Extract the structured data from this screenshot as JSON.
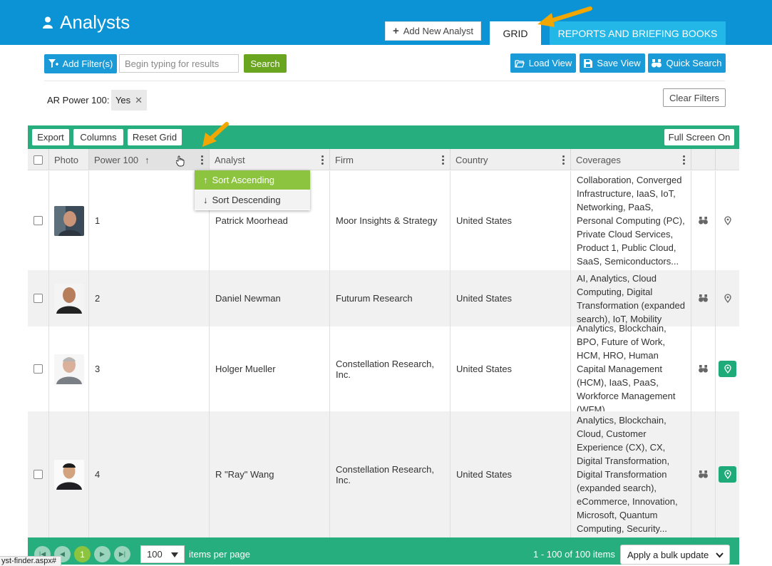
{
  "header": {
    "title": "Analysts",
    "add_analyst_label": "Add New Analyst",
    "tabs": [
      {
        "label": "GRID",
        "active": true
      },
      {
        "label": "REPORTS AND BRIEFING BOOKS",
        "active": false
      }
    ],
    "colors": {
      "bar": "#0b93d5",
      "tab_inactive": "#22b7e6"
    }
  },
  "toolbar": {
    "add_filter_label": "Add Filter(s)",
    "search_placeholder": "Begin typing for results",
    "search_value": "",
    "search_label": "Search",
    "load_view_label": "Load View",
    "save_view_label": "Save View",
    "quick_search_label": "Quick Search"
  },
  "filters": {
    "label": "AR Power 100:",
    "chip_value": "Yes",
    "clear_label": "Clear Filters"
  },
  "grid_toolbar": {
    "export_label": "Export",
    "columns_label": "Columns",
    "reset_label": "Reset Grid",
    "fullscreen_label": "Full Screen On",
    "color": "#27ae7f"
  },
  "columns": [
    "Photo",
    "Power 100",
    "Analyst",
    "Firm",
    "Country",
    "Coverages"
  ],
  "sort_menu": {
    "ascending": "Sort Ascending",
    "descending": "Sort Descending",
    "highlight": "#8cc43f"
  },
  "rows": [
    {
      "rank": "1",
      "analyst": "Patrick Moorhead",
      "firm": "Moor Insights & Strategy",
      "country": "United States",
      "coverages": "Collaboration, Converged Infrastructure, IaaS, IoT, Networking, PaaS, Personal Computing (PC), Private Cloud Services, Product 1, Public Cloud, SaaS, Semiconductors...",
      "pin_active": false
    },
    {
      "rank": "2",
      "analyst": "Daniel Newman",
      "firm": "Futurum Research",
      "country": "United States",
      "coverages": "AI, Analytics, Cloud Computing, Digital Transformation (expanded search), IoT, Mobility",
      "pin_active": false
    },
    {
      "rank": "3",
      "analyst": "Holger Mueller",
      "firm": "Constellation Research, Inc.",
      "country": "United States",
      "coverages": "Analytics, Blockchain, BPO, Future of Work, HCM, HRO, Human Capital Management (HCM), IaaS, PaaS, Workforce Management (WFM)",
      "pin_active": true
    },
    {
      "rank": "4",
      "analyst": "R \"Ray\" Wang",
      "firm": "Constellation Research, Inc.",
      "country": "United States",
      "coverages": "Analytics, Blockchain, Cloud, Customer Experience (CX), CX, Digital Transformation, Digital Transformation (expanded search), eCommerce, Innovation, Microsoft, Quantum Computing, Security...",
      "pin_active": true
    }
  ],
  "pager": {
    "current_page": "1",
    "page_size": "100",
    "per_page_label": "items per page",
    "count_label": "1 - 100 of 100 items",
    "bulk_label": "Apply a bulk update"
  },
  "status_bar": {
    "url": "yst-finder.aspx#"
  }
}
